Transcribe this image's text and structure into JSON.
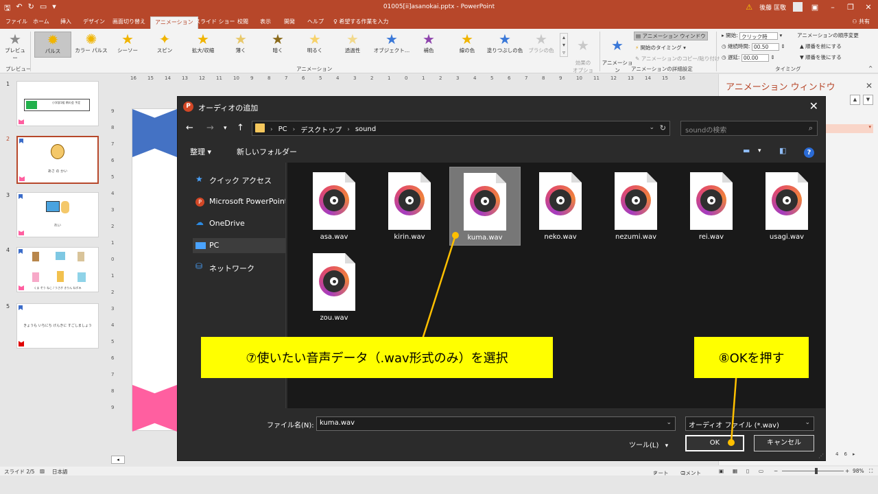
{
  "app": {
    "title": "01005[ii]asanokai.pptx  -  PowerPoint",
    "user": "後藤 匡敬",
    "share": "共有"
  },
  "menu": {
    "tabs": [
      "ファイル",
      "ホーム",
      "挿入",
      "デザイン",
      "画面切り替え",
      "アニメーション",
      "スライド ショー",
      "校閲",
      "表示",
      "開発",
      "ヘルプ",
      "希望する作業を入力"
    ]
  },
  "ribbon": {
    "preview": "プレビュー",
    "preview_group": "プレビュー",
    "effects": [
      "パルス",
      "カラー パルス",
      "シーソー",
      "スピン",
      "拡大/収縮",
      "薄く",
      "暗く",
      "明るく",
      "透過性",
      "オブジェクト…",
      "補色",
      "線の色",
      "塗りつぶしの色",
      "ブラシの色"
    ],
    "effect_options": "効果の\nオプション",
    "animation_group": "アニメーション",
    "add_animation": "アニメーション\nの追加",
    "animation_window": "アニメーション ウィンドウ",
    "start_timing": "開始のタイミング",
    "copy_paste": "アニメーションのコピー/貼り付け",
    "detail_group": "アニメーションの詳細設定",
    "start_label": "開始:",
    "start_value": "クリック時",
    "duration_label": "継続時間:",
    "duration_value": "00.50",
    "delay_label": "遅延:",
    "delay_value": "00.00",
    "order_label": "アニメーションの順序変更",
    "move_earlier": "順番を前にする",
    "move_later": "順番を後にする",
    "timing_group": "タイミング"
  },
  "thumbnails": [
    {
      "num": "1",
      "text": "小学部1組 朝の会 予定"
    },
    {
      "num": "2",
      "text": "あさ の かい"
    },
    {
      "num": "3",
      "text": "れい"
    },
    {
      "num": "4",
      "text": "くま ぞう ねこ / うさぎ きりん ねずみ"
    },
    {
      "num": "5",
      "text": "きょうも いちにち げんきに すごしましょう"
    }
  ],
  "ruler": {
    "h": [
      "16",
      "15",
      "14",
      "13",
      "12",
      "11",
      "10",
      "9",
      "8",
      "7",
      "6",
      "5",
      "4",
      "3",
      "2",
      "1",
      "0",
      "1",
      "2",
      "3",
      "4",
      "5",
      "6",
      "7",
      "8",
      "9",
      "10",
      "11",
      "12",
      "13",
      "14",
      "15",
      "16"
    ],
    "v": [
      "9",
      "8",
      "7",
      "6",
      "5",
      "4",
      "3",
      "2",
      "1",
      "0",
      "1",
      "2",
      "3",
      "4",
      "5",
      "6",
      "7",
      "8",
      "9"
    ]
  },
  "anim_pane": {
    "title": "アニメーション ウィンドウ",
    "zoom_ticks": [
      "4",
      "6"
    ]
  },
  "status": {
    "slide": "スライド 2/5",
    "lang": "日本語",
    "notes": "ノート",
    "comments": "コメント",
    "zoom": "98%"
  },
  "dialog": {
    "title": "オーディオの追加",
    "path": [
      "PC",
      "デスクトップ",
      "sound"
    ],
    "search_placeholder": "soundの検索",
    "organize": "整理",
    "new_folder": "新しいフォルダー",
    "nav": [
      "クイック アクセス",
      "Microsoft PowerPoint",
      "OneDrive",
      "PC",
      "ネットワーク"
    ],
    "files": [
      "asa.wav",
      "kirin.wav",
      "kuma.wav",
      "neko.wav",
      "nezumi.wav",
      "rei.wav",
      "usagi.wav",
      "zou.wav"
    ],
    "selected_file": "kuma.wav",
    "filename_label": "ファイル名(N):",
    "filename_value": "kuma.wav",
    "filetype_value": "オーディオ ファイル (*.wav)",
    "tools": "ツール(L)",
    "ok": "OK",
    "cancel": "キャンセル"
  },
  "callouts": {
    "select": "⑦使いたい音声データ（.wav形式のみ）を選択",
    "ok": "⑧OKを押す"
  },
  "colors": {
    "accent": "#b7472a",
    "callout": "#ffff00",
    "connector": "#ffc000"
  }
}
